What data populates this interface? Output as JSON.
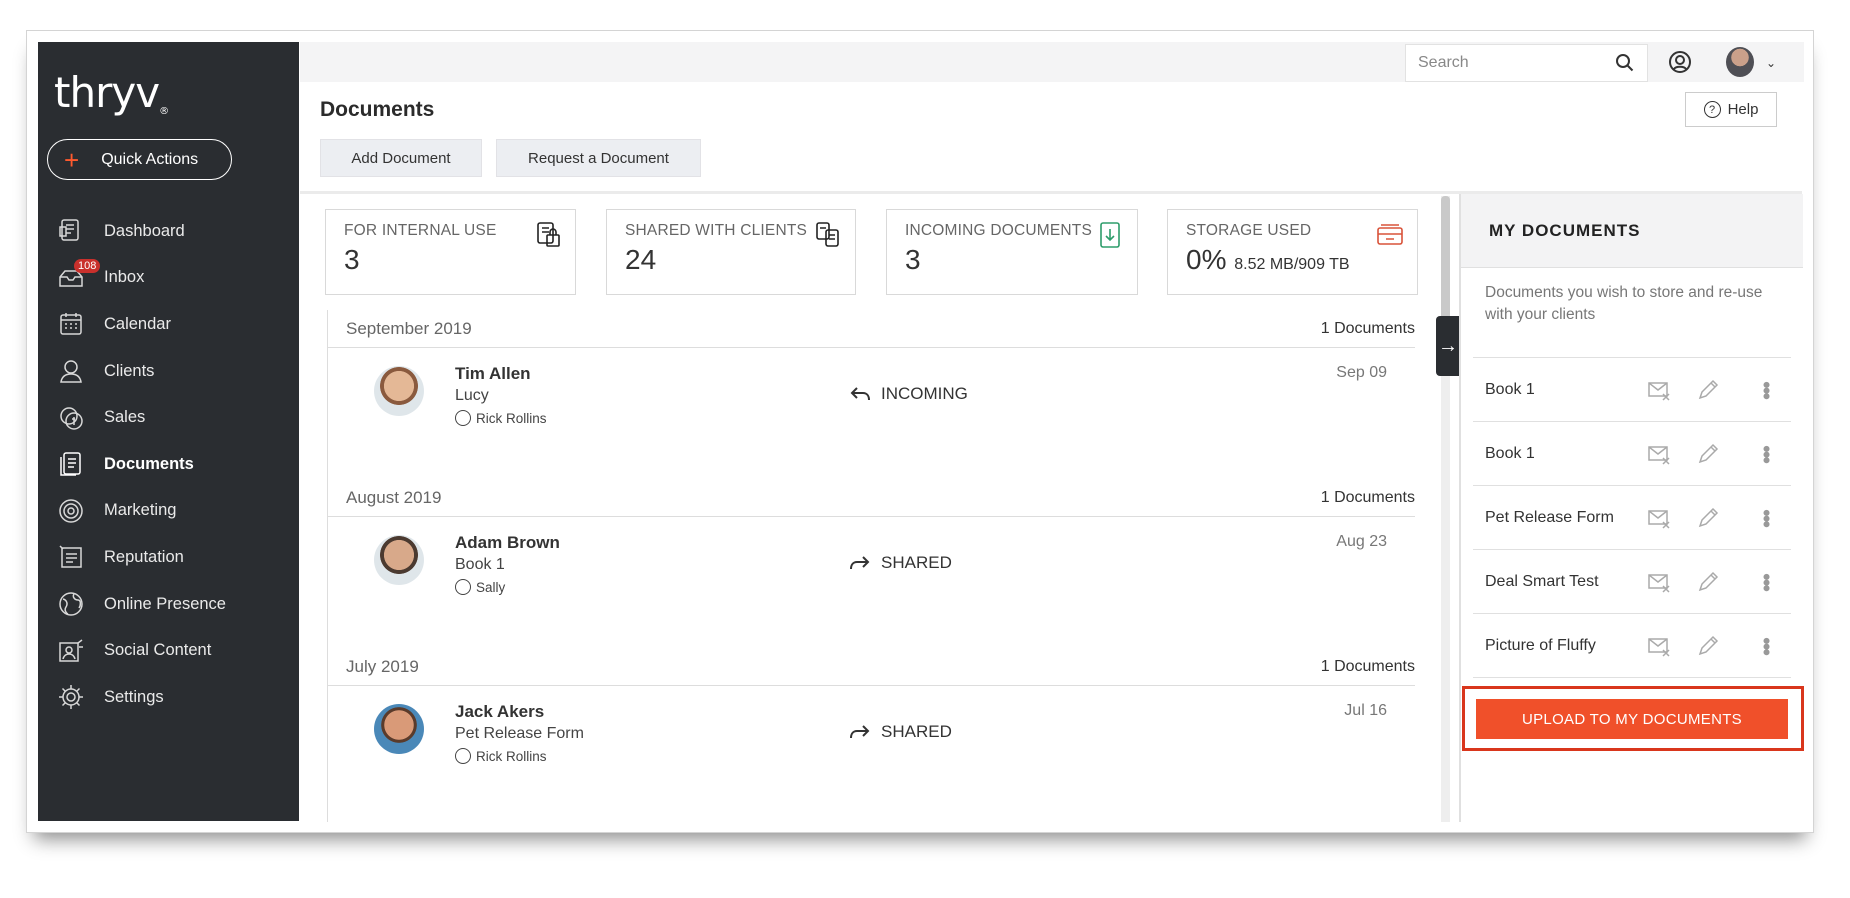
{
  "brand": {
    "logo": "thryv",
    "trademark": "®",
    "accent": "#ff5a2e"
  },
  "sidebar": {
    "quick_actions": "Quick Actions",
    "items": [
      {
        "label": "Dashboard",
        "icon": "dashboard-icon"
      },
      {
        "label": "Inbox",
        "icon": "inbox-icon",
        "badge": "108"
      },
      {
        "label": "Calendar",
        "icon": "calendar-icon"
      },
      {
        "label": "Clients",
        "icon": "clients-icon"
      },
      {
        "label": "Sales",
        "icon": "sales-icon"
      },
      {
        "label": "Documents",
        "icon": "documents-icon",
        "active": true
      },
      {
        "label": "Marketing",
        "icon": "marketing-icon"
      },
      {
        "label": "Reputation",
        "icon": "reputation-icon"
      },
      {
        "label": "Online Presence",
        "icon": "globe-icon"
      },
      {
        "label": "Social Content",
        "icon": "social-content-icon"
      },
      {
        "label": "Settings",
        "icon": "gear-icon"
      }
    ]
  },
  "topbar": {
    "search_placeholder": "Search"
  },
  "header": {
    "title": "Documents",
    "add_document": "Add Document",
    "request_document": "Request a Document",
    "help": "Help"
  },
  "stats": [
    {
      "label": "FOR INTERNAL USE",
      "value": "3",
      "icon": "lock-document-icon",
      "color": "#222"
    },
    {
      "label": "SHARED WITH CLIENTS",
      "value": "24",
      "icon": "shared-documents-icon",
      "color": "#222"
    },
    {
      "label": "INCOMING DOCUMENTS",
      "value": "3",
      "icon": "incoming-document-icon",
      "color": "#2e9d6b"
    },
    {
      "label": "STORAGE USED",
      "value": "0%",
      "sub": "8.52 MB/909 TB",
      "icon": "storage-icon",
      "color": "#d9533a"
    }
  ],
  "groups": [
    {
      "month": "September 2019",
      "count": "1 Documents",
      "row": {
        "name": "Tim Allen",
        "doc": "Lucy",
        "owner": "Rick Rollins",
        "kind": "INCOMING",
        "date": "Sep 09"
      }
    },
    {
      "month": "August 2019",
      "count": "1 Documents",
      "row": {
        "name": "Adam Brown",
        "doc": "Book 1",
        "owner": "Sally",
        "kind": "SHARED",
        "date": "Aug 23"
      }
    },
    {
      "month": "July 2019",
      "count": "1 Documents",
      "row": {
        "name": "Jack Akers",
        "doc": "Pet Release Form",
        "owner": "Rick Rollins",
        "kind": "SHARED",
        "date": "Jul 16"
      }
    }
  ],
  "panel": {
    "title": "MY DOCUMENTS",
    "description": "Documents you wish to store and re-use with your clients",
    "items": [
      "Book 1",
      "Book 1",
      "Pet Release Form",
      "Deal Smart Test",
      "Picture of Fluffy"
    ],
    "upload": "UPLOAD TO MY DOCUMENTS"
  }
}
